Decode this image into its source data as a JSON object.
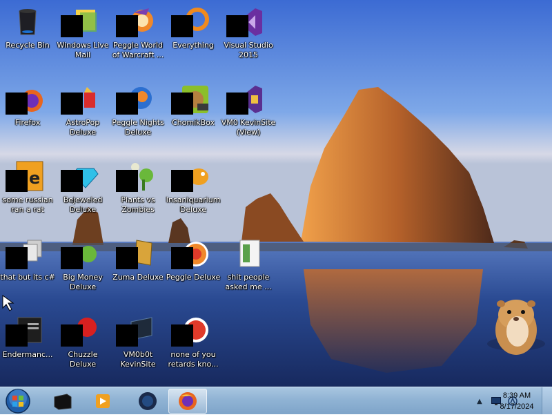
{
  "desktop": {
    "icons": [
      {
        "label": "Recycle Bin"
      },
      {
        "label": "Windows Live Mail"
      },
      {
        "label": "Peggle World of Warcraft ..."
      },
      {
        "label": "Everything"
      },
      {
        "label": "Visual Studio 2015"
      },
      {
        "label": "Firefox"
      },
      {
        "label": "AstroPop Deluxe"
      },
      {
        "label": "Peggle Nights Deluxe"
      },
      {
        "label": "ChomikBox"
      },
      {
        "label": "VM0 KevinSite (View)"
      },
      {
        "label": "some russian ran a rat"
      },
      {
        "label": "Bejeweled Deluxe"
      },
      {
        "label": "Plants vs Zombies"
      },
      {
        "label": "Insaniquarium Deluxe"
      },
      {
        "label": "that but its c#"
      },
      {
        "label": "Big Money Deluxe"
      },
      {
        "label": "Zuma Deluxe"
      },
      {
        "label": "Peggle Deluxe"
      },
      {
        "label": "shit people asked me ..."
      },
      {
        "label": "Endermanc..."
      },
      {
        "label": "Chuzzle Deluxe"
      },
      {
        "label": "VM0b0t KevinSite"
      },
      {
        "label": "none of you retards kno..."
      }
    ]
  },
  "taskbar": {
    "items": [
      {
        "icon": "media-center-icon"
      },
      {
        "icon": "media-player-icon"
      },
      {
        "icon": "globe-app-icon"
      },
      {
        "icon": "firefox-icon",
        "active": true
      }
    ],
    "tray": {
      "chevron": "▲"
    },
    "clock": {
      "time": "8:39 AM",
      "date": "8/17/2024"
    }
  },
  "colors": {
    "taskbar": "#90b3d4",
    "sky_top": "#3f6fd4",
    "sea": "#1f3c7a",
    "rock": "#b9652a"
  }
}
